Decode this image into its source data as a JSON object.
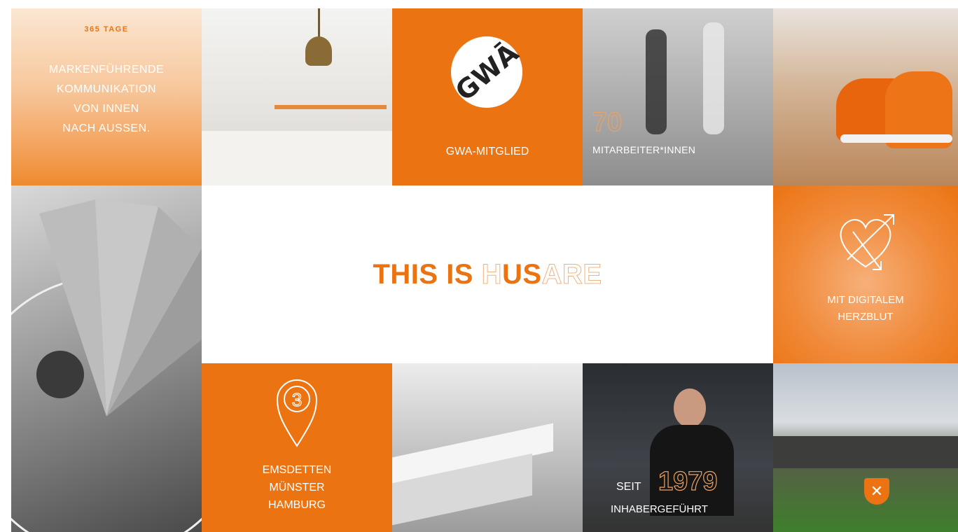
{
  "tile_1": {
    "tag": "365 TAGE",
    "claim_lines": [
      "MARKENFÜHRENDE",
      "KOMMUNIKATION",
      "VON INNEN",
      "NACH AUSSEN."
    ]
  },
  "tile_gwa": {
    "logo_text": "gwā",
    "label": "GWA-MITGLIED"
  },
  "tile_employees": {
    "number": "70",
    "label": "MITARBEITER*INNEN"
  },
  "center": {
    "headline_part_1": "THIS IS ",
    "headline_part_2": "H",
    "headline_part_3": "US",
    "headline_part_4": "ARE"
  },
  "tile_heart": {
    "label_lines": [
      "MIT DIGITALEM",
      "HERZBLUT"
    ]
  },
  "tile_locations": {
    "pin_number": "3",
    "cities": [
      "EMSDETTEN",
      "MÜNSTER",
      "HAMBURG"
    ]
  },
  "tile_founded": {
    "seit": "SEIT",
    "year": "1979",
    "label": "INHABERGEFÜHRT"
  },
  "tile_team": {
    "badge_icon": "crossed-tools-icon"
  },
  "colors": {
    "brand_orange": "#ec7311",
    "outline_orange": "#e9a264"
  }
}
